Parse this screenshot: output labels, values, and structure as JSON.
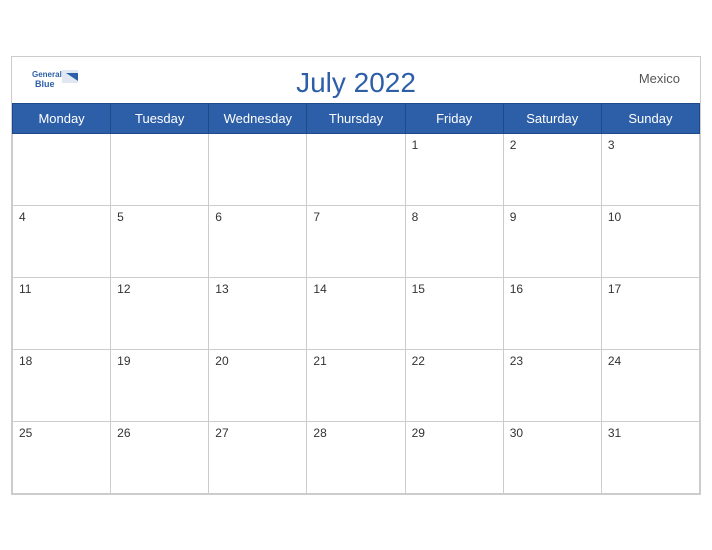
{
  "header": {
    "title": "July 2022",
    "country": "Mexico",
    "logo_general": "General",
    "logo_blue": "Blue"
  },
  "weekdays": [
    "Monday",
    "Tuesday",
    "Wednesday",
    "Thursday",
    "Friday",
    "Saturday",
    "Sunday"
  ],
  "weeks": [
    [
      null,
      null,
      null,
      null,
      1,
      2,
      3
    ],
    [
      4,
      5,
      6,
      7,
      8,
      9,
      10
    ],
    [
      11,
      12,
      13,
      14,
      15,
      16,
      17
    ],
    [
      18,
      19,
      20,
      21,
      22,
      23,
      24
    ],
    [
      25,
      26,
      27,
      28,
      29,
      30,
      31
    ]
  ]
}
